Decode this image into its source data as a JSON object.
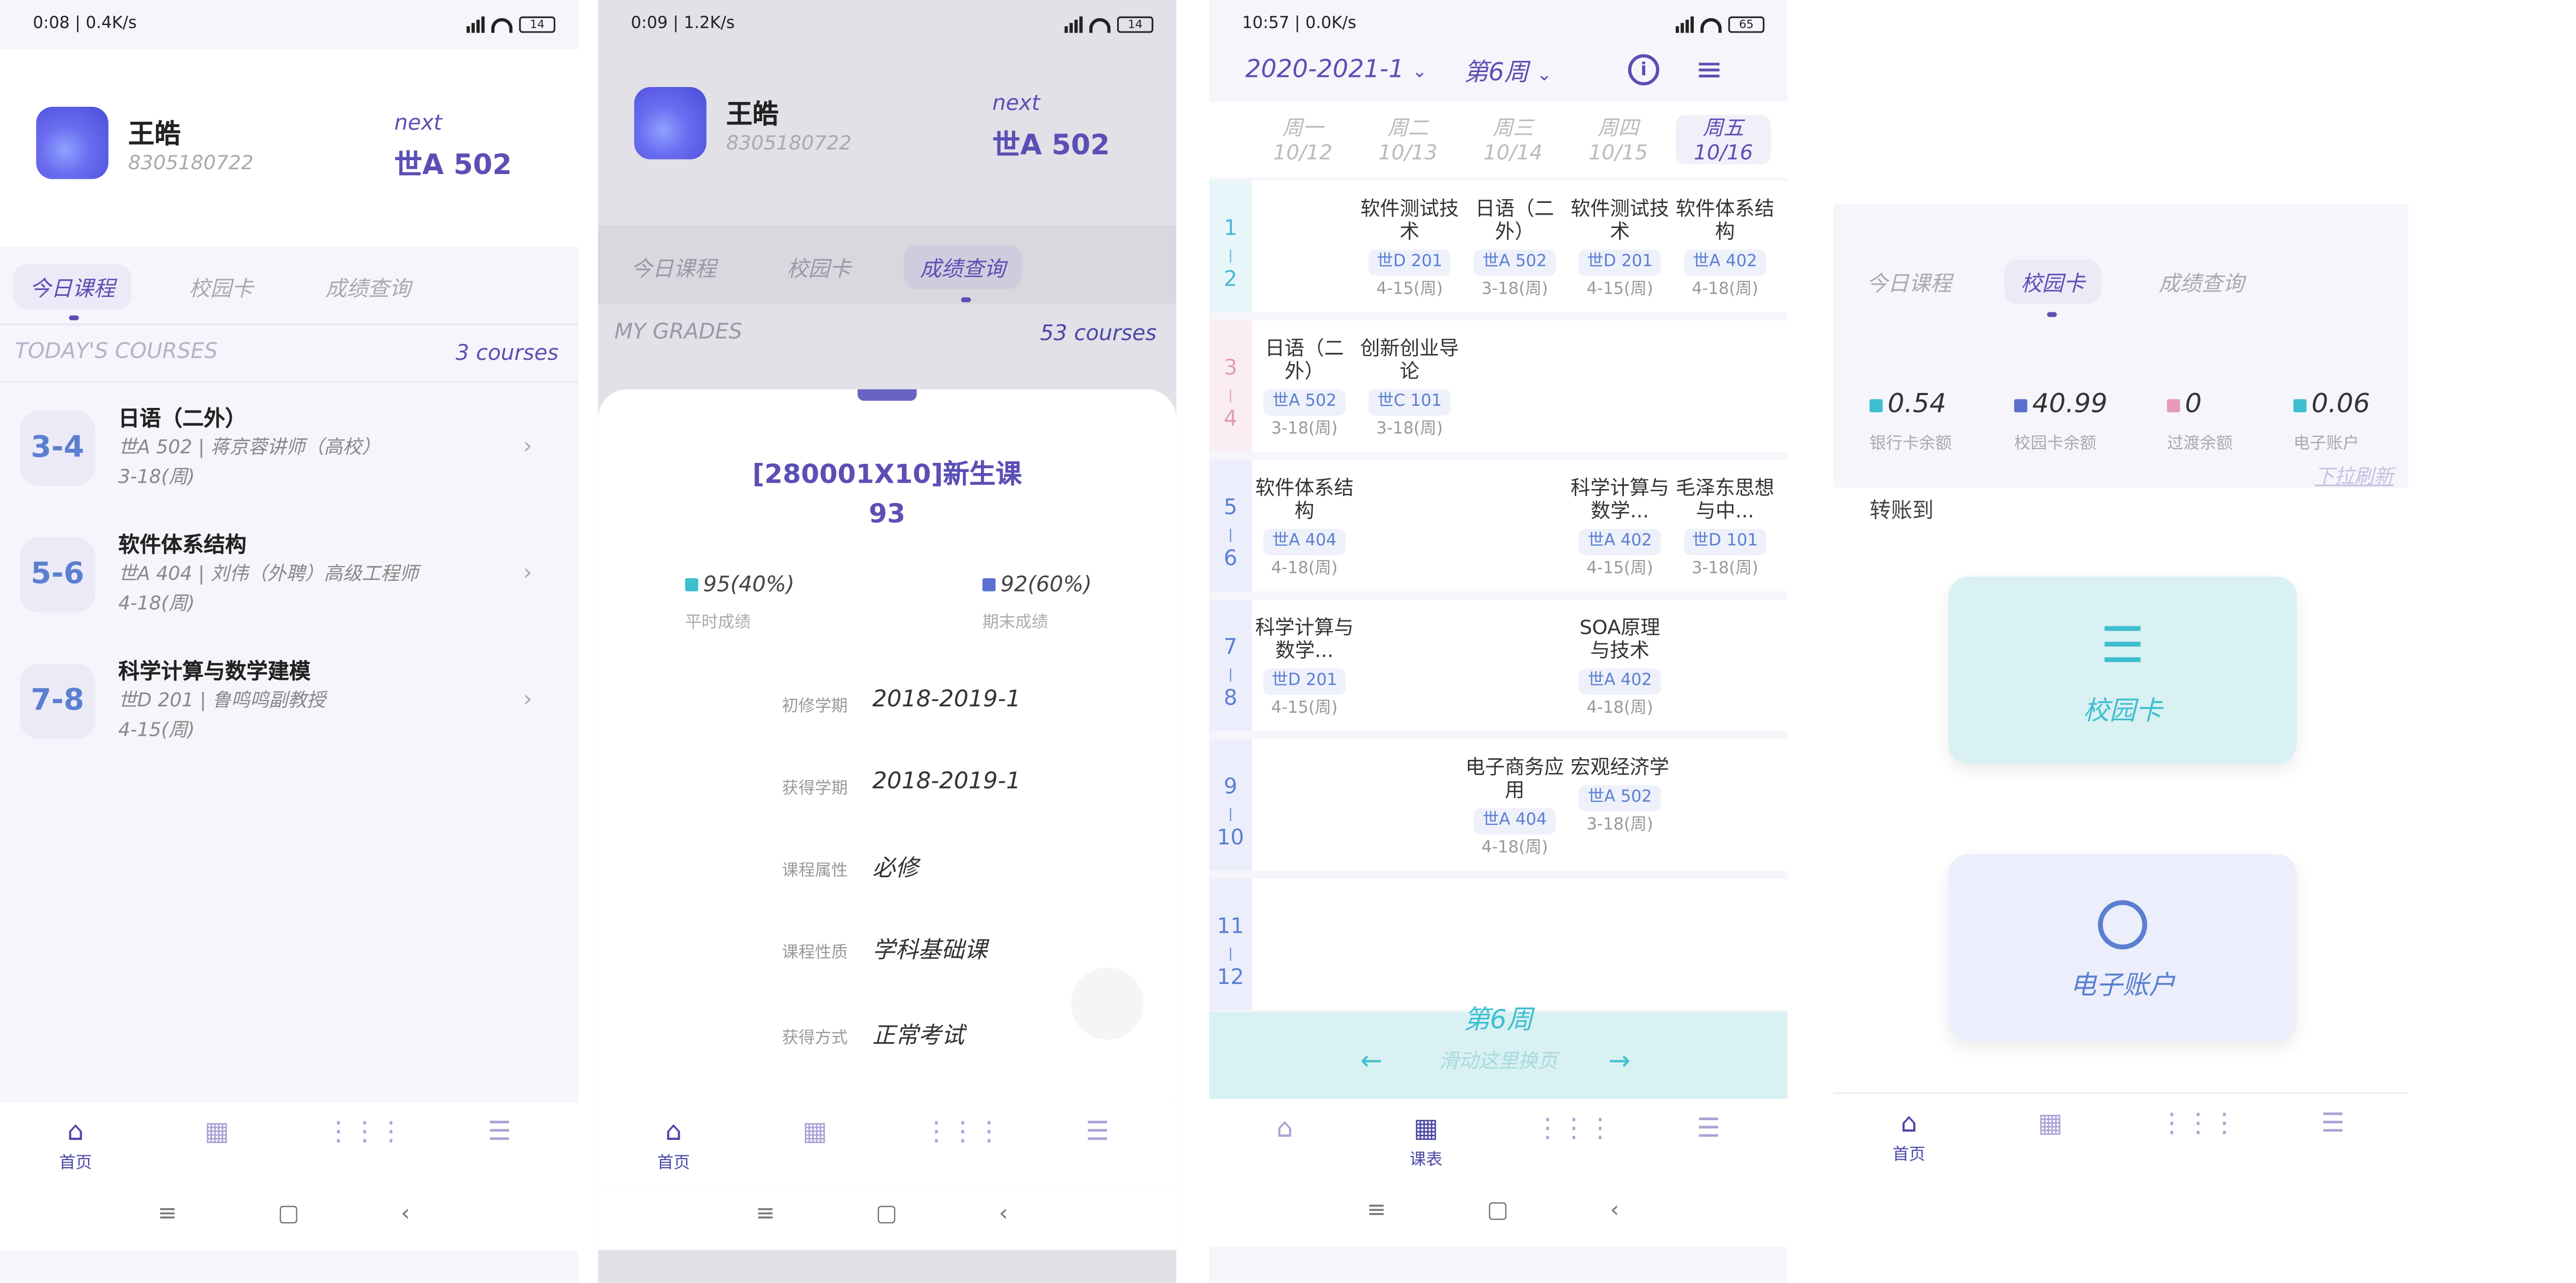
{
  "panel1": {
    "status": {
      "time": "0:08 | 0.4K/s",
      "battery": "14"
    },
    "user": {
      "name": "王皓",
      "id": "8305180722"
    },
    "next": {
      "label": "next",
      "value": "世A 502"
    },
    "tabs": [
      "今日课程",
      "校园卡",
      "成绩查询"
    ],
    "section": {
      "title": "TODAY'S COURSES",
      "count": "3 courses"
    },
    "courses": [
      {
        "period": "3-4",
        "title": "日语（二外）",
        "detail": "世A 502 | 蒋京蓉讲师（高校）",
        "weeks": "3-18(周)"
      },
      {
        "period": "5-6",
        "title": "软件体系结构",
        "detail": "世A 404 | 刘伟（外聘）高级工程师",
        "weeks": "4-18(周)"
      },
      {
        "period": "7-8",
        "title": "科学计算与数学建模",
        "detail": "世D 201 | 鲁鸣鸣副教授",
        "weeks": "4-15(周)"
      }
    ],
    "nav_home": "首页"
  },
  "panel2": {
    "status": {
      "time": "0:09 | 1.2K/s",
      "battery": "14"
    },
    "user": {
      "name": "王皓",
      "id": "8305180722"
    },
    "next": {
      "label": "next",
      "value": "世A 502"
    },
    "tabs": [
      "今日课程",
      "校园卡",
      "成绩查询"
    ],
    "section": {
      "title": "MY GRADES",
      "count": "53 courses"
    },
    "sheet": {
      "title": "[280001X10]新生课",
      "score": "93",
      "regular": {
        "value": "95(40%)",
        "label": "平时成绩",
        "color": "#3ebfcf"
      },
      "final": {
        "value": "92(60%)",
        "label": "期末成绩",
        "color": "#5b6fd1"
      },
      "rows": [
        {
          "k": "初修学期",
          "v": "2018-2019-1"
        },
        {
          "k": "获得学期",
          "v": "2018-2019-1"
        },
        {
          "k": "课程属性",
          "v": "必修"
        },
        {
          "k": "课程性质",
          "v": "学科基础课"
        },
        {
          "k": "获得方式",
          "v": "正常考试"
        }
      ]
    },
    "nav_home": "首页"
  },
  "panel3": {
    "status": {
      "time": "10:57 | 0.0K/s",
      "battery": "65"
    },
    "term": "2020-2021-1",
    "week": "第6周",
    "days": [
      {
        "d": "周一",
        "date": "10/12"
      },
      {
        "d": "周二",
        "date": "10/13"
      },
      {
        "d": "周三",
        "date": "10/14"
      },
      {
        "d": "周四",
        "date": "10/15"
      },
      {
        "d": "周五",
        "date": "10/16"
      }
    ],
    "periods": [
      [
        "1",
        "2"
      ],
      [
        "3",
        "4"
      ],
      [
        "5",
        "6"
      ],
      [
        "7",
        "8"
      ],
      [
        "9",
        "10"
      ],
      [
        "11",
        "12"
      ]
    ],
    "period_colors": [
      "#4fb6d3",
      "#e59ab8",
      "#5b7fd1",
      "#5b7fd1",
      "#5b7fd1",
      "#5b7fd1"
    ],
    "cells": [
      {
        "r": 0,
        "c": 1,
        "name": "软件测试技术",
        "room": "世D 201",
        "weeks": "4-15(周)"
      },
      {
        "r": 0,
        "c": 2,
        "name": "日语（二外）",
        "room": "世A 502",
        "weeks": "3-18(周)"
      },
      {
        "r": 0,
        "c": 3,
        "name": "软件测试技术",
        "room": "世D 201",
        "weeks": "4-15(周)"
      },
      {
        "r": 0,
        "c": 4,
        "name": "软件体系结构",
        "room": "世A 402",
        "weeks": "4-18(周)"
      },
      {
        "r": 1,
        "c": 0,
        "name": "日语（二外）",
        "room": "世A 502",
        "weeks": "3-18(周)"
      },
      {
        "r": 1,
        "c": 1,
        "name": "创新创业导论",
        "room": "世C 101",
        "weeks": "3-18(周)"
      },
      {
        "r": 2,
        "c": 0,
        "name": "软件体系结构",
        "room": "世A 404",
        "weeks": "4-18(周)"
      },
      {
        "r": 2,
        "c": 3,
        "name": "科学计算与数学...",
        "room": "世A 402",
        "weeks": "4-15(周)"
      },
      {
        "r": 2,
        "c": 4,
        "name": "毛泽东思想与中...",
        "room": "世D 101",
        "weeks": "3-18(周)"
      },
      {
        "r": 3,
        "c": 0,
        "name": "科学计算与数学...",
        "room": "世D 201",
        "weeks": "4-15(周)"
      },
      {
        "r": 3,
        "c": 3,
        "name": "SOA原理与技术",
        "room": "世A 402",
        "weeks": "4-18(周)"
      },
      {
        "r": 4,
        "c": 2,
        "name": "电子商务应用",
        "room": "世A 404",
        "weeks": "4-18(周)"
      },
      {
        "r": 4,
        "c": 3,
        "name": "宏观经济学",
        "room": "世A 502",
        "weeks": "3-18(周)"
      }
    ],
    "footer": {
      "week": "第6周",
      "hint": "滑动这里换页"
    },
    "nav_schedule": "课表"
  },
  "panel4": {
    "tabs": [
      "今日课程",
      "校园卡",
      "成绩查询"
    ],
    "balances": [
      {
        "value": "0.54",
        "label": "银行卡余额",
        "color": "#3ebfcf"
      },
      {
        "value": "40.99",
        "label": "校园卡余额",
        "color": "#5b6fd1"
      },
      {
        "value": "0",
        "label": "过渡余额",
        "color": "#e59ab8"
      },
      {
        "value": "0.06",
        "label": "电子账户",
        "color": "#3ebfcf"
      }
    ],
    "refresh": "下拉刷新",
    "transfer": "转账到",
    "cards": [
      {
        "label": "校园卡"
      },
      {
        "label": "电子账户"
      }
    ],
    "nav_home": "首页"
  }
}
